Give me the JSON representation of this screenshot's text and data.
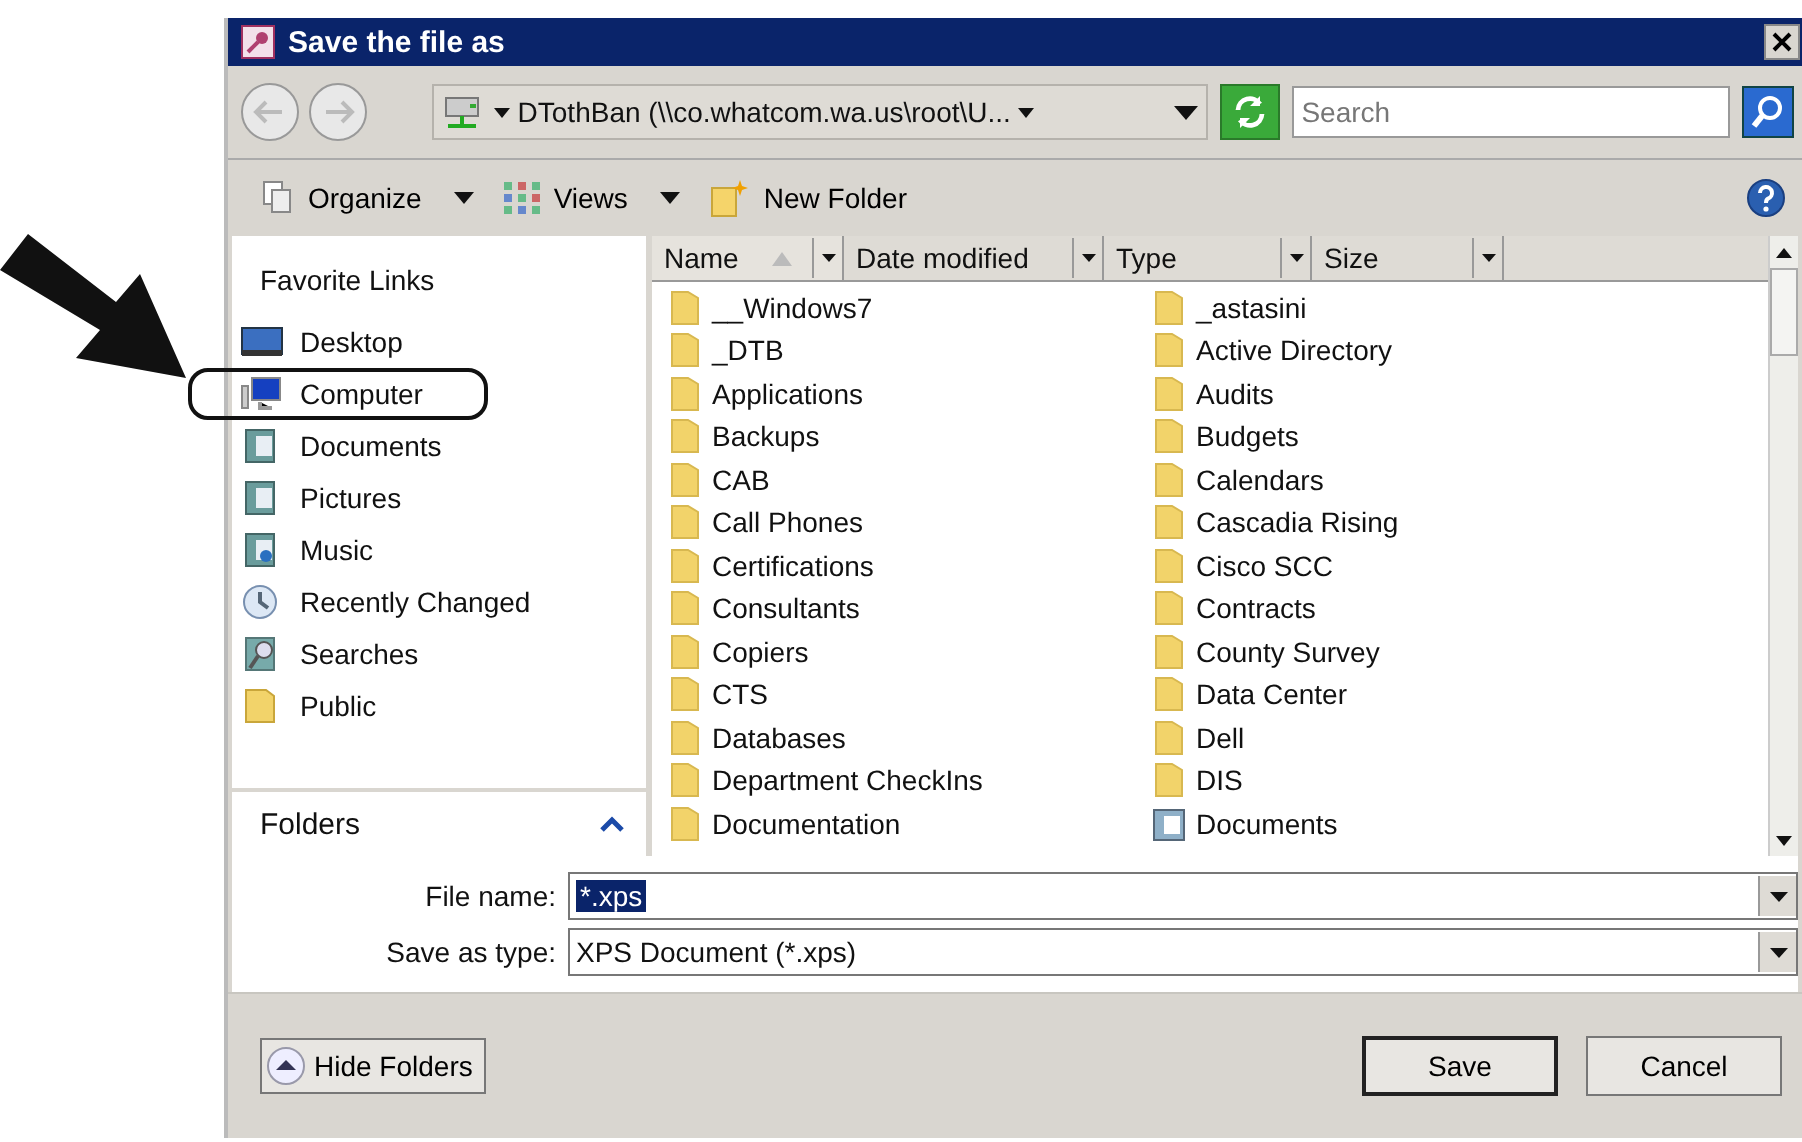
{
  "window": {
    "title": "Save the file as"
  },
  "navigation": {
    "address": "DTothBan (\\\\co.whatcom.wa.us\\root\\U...",
    "search": {
      "placeholder": "Search"
    }
  },
  "toolbar": [
    {
      "label": "Organize",
      "kind": "menu"
    },
    {
      "label": "Views",
      "kind": "menu"
    },
    {
      "label": "New Folder",
      "kind": "button"
    }
  ],
  "favorite_links": {
    "title": "Favorite Links",
    "items": [
      {
        "label": "Desktop",
        "circled": false
      },
      {
        "label": "Computer",
        "circled": true
      },
      {
        "label": "Documents",
        "circled": false
      },
      {
        "label": "Pictures",
        "circled": false
      },
      {
        "label": "Music",
        "circled": false
      },
      {
        "label": "Recently Changed",
        "circled": false
      },
      {
        "label": "Searches",
        "circled": false
      },
      {
        "label": "Public",
        "circled": false
      }
    ]
  },
  "folders_pane": {
    "title": "Folders"
  },
  "file_list": {
    "columns": [
      {
        "label": "Name",
        "sorted": true
      },
      {
        "label": "Date modified",
        "sorted": false
      },
      {
        "label": "Type",
        "sorted": false
      },
      {
        "label": "Size",
        "sorted": false
      }
    ],
    "items": [
      {
        "name": "__Windows7",
        "kind": "folder"
      },
      {
        "name": "_DTB",
        "kind": "folder"
      },
      {
        "name": "Applications",
        "kind": "folder"
      },
      {
        "name": "Backups",
        "kind": "folder"
      },
      {
        "name": "CAB",
        "kind": "folder"
      },
      {
        "name": "Call Phones",
        "kind": "folder"
      },
      {
        "name": "Certifications",
        "kind": "folder"
      },
      {
        "name": "Consultants",
        "kind": "folder"
      },
      {
        "name": "Copiers",
        "kind": "folder"
      },
      {
        "name": "CTS",
        "kind": "folder"
      },
      {
        "name": "Databases",
        "kind": "folder"
      },
      {
        "name": "Department CheckIns",
        "kind": "folder"
      },
      {
        "name": "Documentation",
        "kind": "folder"
      },
      {
        "name": "_astasini",
        "kind": "folder"
      },
      {
        "name": "Active Directory",
        "kind": "folder"
      },
      {
        "name": "Audits",
        "kind": "folder"
      },
      {
        "name": "Budgets",
        "kind": "folder"
      },
      {
        "name": "Calendars",
        "kind": "folder"
      },
      {
        "name": "Cascadia Rising",
        "kind": "folder"
      },
      {
        "name": "Cisco SCC",
        "kind": "folder"
      },
      {
        "name": "Contracts",
        "kind": "folder"
      },
      {
        "name": "County Survey",
        "kind": "folder"
      },
      {
        "name": "Data Center",
        "kind": "folder"
      },
      {
        "name": "Dell",
        "kind": "folder"
      },
      {
        "name": "DIS",
        "kind": "folder"
      },
      {
        "name": "Documents",
        "kind": "library"
      }
    ]
  },
  "form": {
    "file_name": {
      "label": "File name:",
      "value": "*.xps",
      "selected": true
    },
    "save_as_type": {
      "label": "Save as type:",
      "value": "XPS Document (*.xps)"
    }
  },
  "buttons": {
    "hide_folders": "Hide Folders",
    "save": "Save",
    "cancel": "Cancel"
  }
}
